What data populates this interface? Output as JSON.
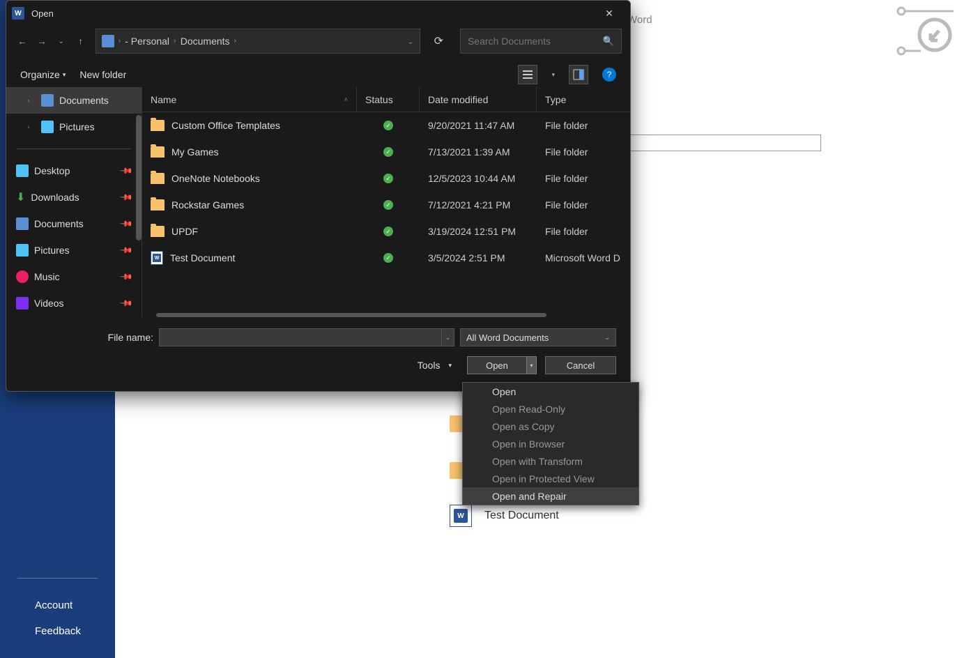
{
  "word_bg": {
    "title_suffix": "Word",
    "sidebar": {
      "account": "Account",
      "feedback": "Feedback"
    },
    "doc_below": "Test Document"
  },
  "dialog": {
    "title": "Open",
    "breadcrumb": {
      "part1": "- Personal",
      "part2": "Documents"
    },
    "search_placeholder": "Search Documents",
    "toolbar": {
      "organize": "Organize",
      "new_folder": "New folder"
    },
    "sidebar": {
      "tree": [
        {
          "label": "Documents",
          "selected": true
        },
        {
          "label": "Pictures",
          "selected": false
        }
      ],
      "quick": [
        {
          "label": "Desktop"
        },
        {
          "label": "Downloads"
        },
        {
          "label": "Documents"
        },
        {
          "label": "Pictures"
        },
        {
          "label": "Music"
        },
        {
          "label": "Videos"
        }
      ]
    },
    "columns": {
      "name": "Name",
      "status": "Status",
      "date": "Date modified",
      "type": "Type"
    },
    "files": [
      {
        "name": "Custom Office Templates",
        "date": "9/20/2021 11:47 AM",
        "type": "File folder",
        "kind": "folder"
      },
      {
        "name": "My Games",
        "date": "7/13/2021 1:39 AM",
        "type": "File folder",
        "kind": "folder"
      },
      {
        "name": "OneNote Notebooks",
        "date": "12/5/2023 10:44 AM",
        "type": "File folder",
        "kind": "folder"
      },
      {
        "name": "Rockstar Games",
        "date": "7/12/2021 4:21 PM",
        "type": "File folder",
        "kind": "folder"
      },
      {
        "name": "UPDF",
        "date": "3/19/2024 12:51 PM",
        "type": "File folder",
        "kind": "folder"
      },
      {
        "name": "Test Document",
        "date": "3/5/2024 2:51 PM",
        "type": "Microsoft Word D",
        "kind": "doc"
      }
    ],
    "footer": {
      "file_name_label": "File name:",
      "filter": "All Word Documents",
      "tools": "Tools",
      "open": "Open",
      "cancel": "Cancel"
    },
    "open_menu": [
      {
        "label": "Open",
        "enabled": true,
        "highlight": false
      },
      {
        "label": "Open Read-Only",
        "enabled": false,
        "highlight": false
      },
      {
        "label": "Open as Copy",
        "enabled": false,
        "highlight": false
      },
      {
        "label": "Open in Browser",
        "enabled": false,
        "highlight": false
      },
      {
        "label": "Open with Transform",
        "enabled": false,
        "highlight": false
      },
      {
        "label": "Open in Protected View",
        "enabled": false,
        "highlight": false
      },
      {
        "label": "Open and Repair",
        "enabled": true,
        "highlight": true
      }
    ]
  }
}
